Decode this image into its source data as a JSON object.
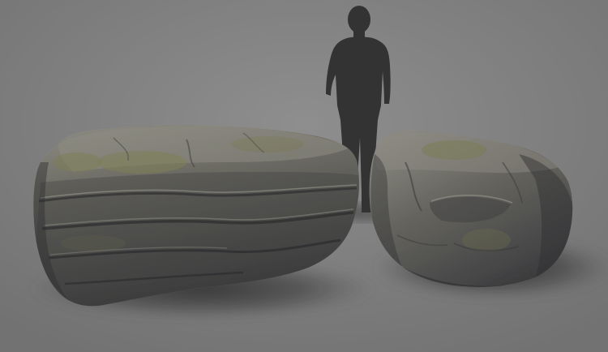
{
  "scene": {
    "subject": "3d-rock-assets-render",
    "colors": {
      "background": "#7a7a7a",
      "background_light": "#8c8c8c",
      "floor_shadow": "#3e3e3e",
      "silhouette": "#333333",
      "rock_light": "#8d8c84",
      "rock_mid": "#62625c",
      "rock_dark": "#36363a",
      "moss": "#7d7e55"
    }
  }
}
